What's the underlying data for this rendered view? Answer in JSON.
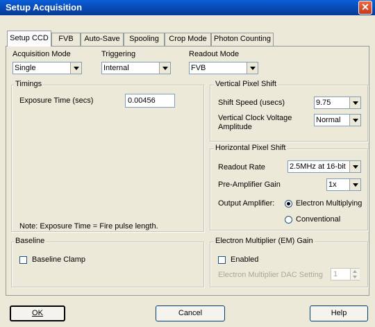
{
  "window": {
    "title": "Setup Acquisition",
    "close_glyph": "✕"
  },
  "tabs": [
    {
      "label": "Setup CCD"
    },
    {
      "label": "FVB"
    },
    {
      "label": "Auto-Save"
    },
    {
      "label": "Spooling"
    },
    {
      "label": "Crop Mode"
    },
    {
      "label": "Photon Counting"
    }
  ],
  "acquisition_mode": {
    "label": "Acquisition Mode",
    "value": "Single"
  },
  "triggering": {
    "label": "Triggering",
    "value": "Internal"
  },
  "readout_mode": {
    "label": "Readout Mode",
    "value": "FVB"
  },
  "timings": {
    "title": "Timings",
    "exposure_label": "Exposure Time (secs)",
    "exposure_value": "0.00456",
    "note": "Note: Exposure Time = Fire pulse length."
  },
  "vertical_shift": {
    "title": "Vertical Pixel Shift",
    "speed_label": "Shift Speed (usecs)",
    "speed_value": "9.75",
    "voltage_label": "Vertical Clock Voltage Amplitude",
    "voltage_value": "Normal"
  },
  "horizontal_shift": {
    "title": "Horizontal Pixel Shift",
    "readout_label": "Readout Rate",
    "readout_value": "2.5MHz at 16-bit",
    "preamp_label": "Pre-Amplifier Gain",
    "preamp_value": "1x",
    "output_label": "Output Amplifier:",
    "em_option": "Electron Multiplying",
    "conv_option": "Conventional"
  },
  "baseline": {
    "title": "Baseline",
    "clamp_label": "Baseline Clamp"
  },
  "em_gain": {
    "title": "Electron Multiplier (EM) Gain",
    "enabled_label": "Enabled",
    "dac_label": "Electron Multiplier DAC Setting",
    "dac_value": "1"
  },
  "buttons": {
    "ok": "OK",
    "cancel": "Cancel",
    "help": "Help"
  }
}
